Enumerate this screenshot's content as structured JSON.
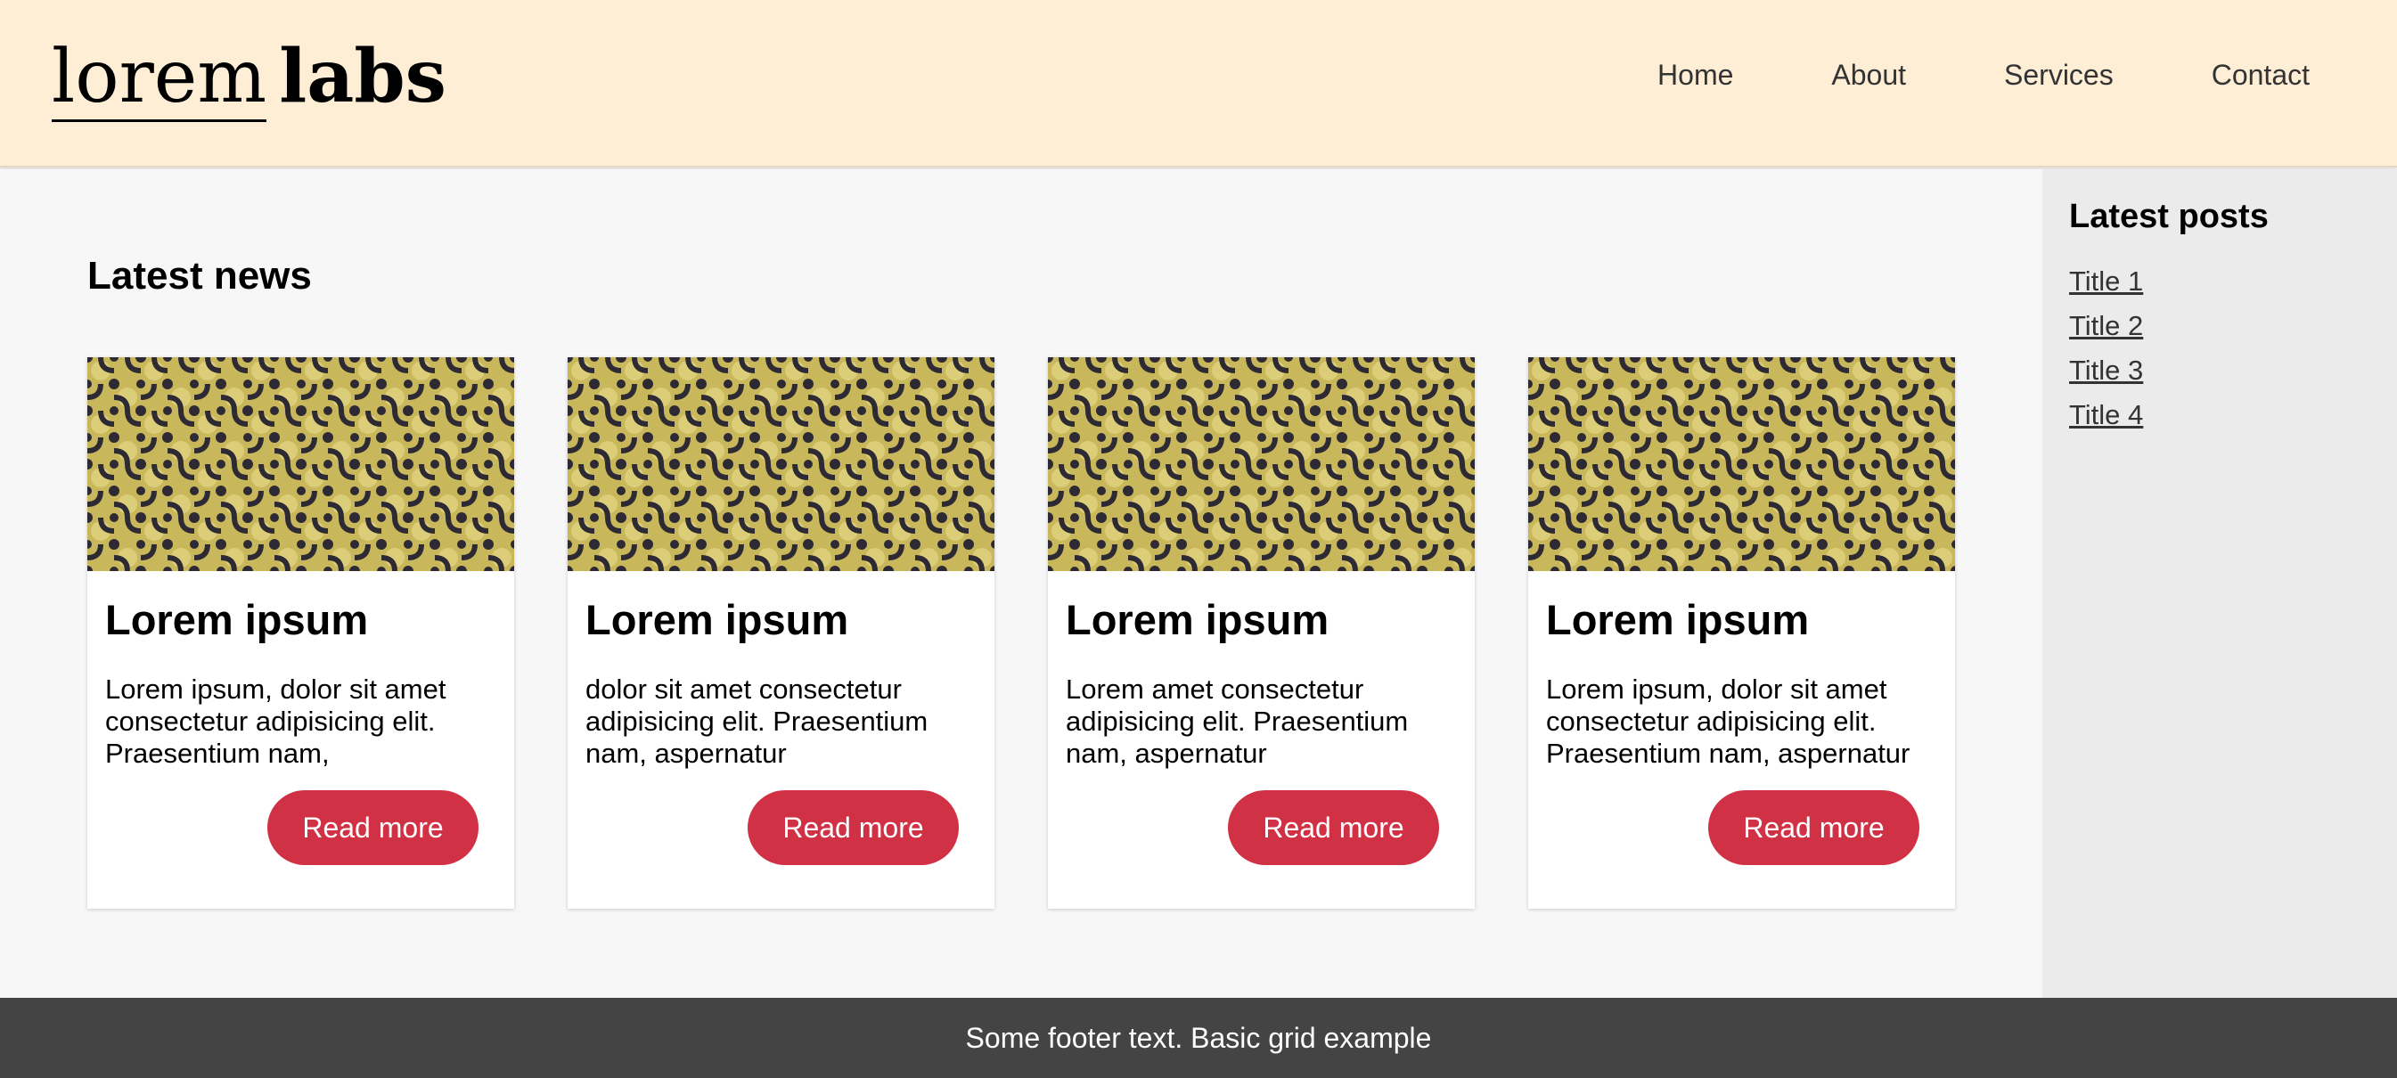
{
  "header": {
    "logo_light": "lorem",
    "logo_bold": "labs",
    "nav": [
      "Home",
      "About",
      "Services",
      "Contact"
    ]
  },
  "main": {
    "title": "Latest news",
    "cards": [
      {
        "title": "Lorem ipsum",
        "text": "Lorem ipsum, dolor sit amet consectetur adipisicing elit. Praesentium nam,",
        "button": "Read more"
      },
      {
        "title": "Lorem ipsum",
        "text": "dolor sit amet consectetur adipisicing elit. Praesentium nam, aspernatur",
        "button": "Read more"
      },
      {
        "title": "Lorem ipsum",
        "text": "Lorem amet consectetur adipisicing elit. Praesentium nam, aspernatur",
        "button": "Read more"
      },
      {
        "title": "Lorem ipsum",
        "text": "Lorem ipsum, dolor sit amet consectetur adipisicing elit. Praesentium nam, aspernatur",
        "button": "Read more"
      }
    ]
  },
  "sidebar": {
    "title": "Latest posts",
    "links": [
      "Title 1",
      "Title 2",
      "Title 3",
      "Title 4"
    ]
  },
  "footer": {
    "text": "Some footer text. Basic grid example"
  },
  "colors": {
    "header_bg": "#ffeed6",
    "button": "#d03144",
    "footer_bg": "#444444",
    "sidebar_bg": "#ebebeb"
  }
}
